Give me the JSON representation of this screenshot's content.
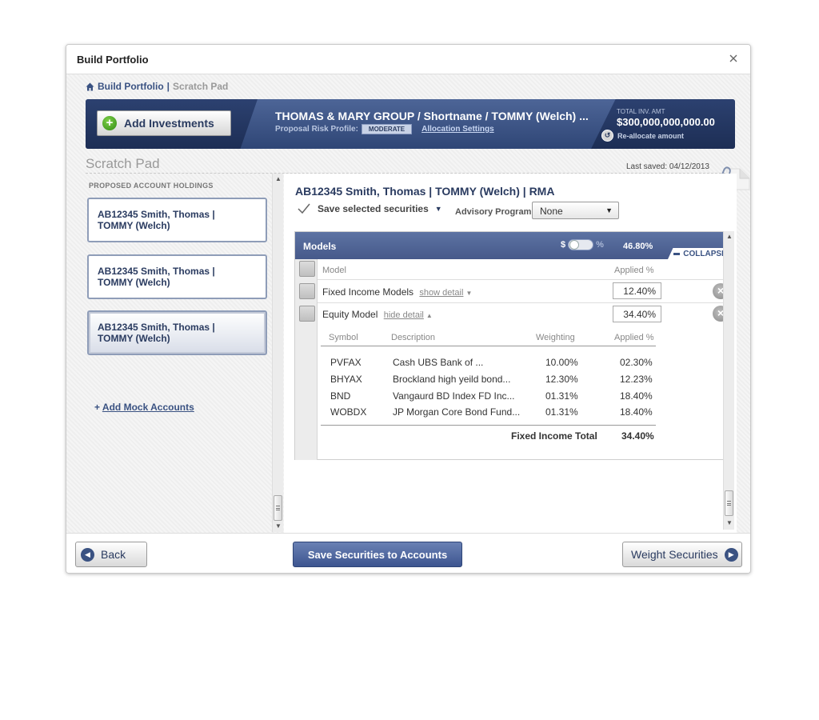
{
  "dialog": {
    "title": "Build Portfolio"
  },
  "breadcrumb": {
    "home_label": "Build Portfolio",
    "separator": "|",
    "current": "Scratch Pad"
  },
  "banner": {
    "add_investments_label": "Add Investments",
    "client_name": "THOMAS & MARY GROUP / Shortname / TOMMY (Welch) ...",
    "risk_label": "Proposal Risk Profile:",
    "risk_value": "MODERATE",
    "allocation_link": "Allocation Settings",
    "total_label": "TOTAL INV. AMT",
    "total_amount": "$300,000,000,000.00",
    "reallocate_label": "Re-allocate amount"
  },
  "scratch": {
    "title": "Scratch Pad",
    "last_saved": "Last saved: 04/12/2013"
  },
  "holdings": {
    "title": "PROPOSED ACCOUNT HOLDINGS",
    "accounts": [
      {
        "line1": "AB12345 Smith, Thomas |",
        "line2": "TOMMY (Welch)"
      },
      {
        "line1": "AB12345 Smith, Thomas |",
        "line2": "TOMMY (Welch)"
      },
      {
        "line1": "AB12345 Smith, Thomas |",
        "line2": "TOMMY (Welch)"
      }
    ],
    "add_mock_prefix": "+",
    "add_mock_label": "Add Mock Accounts"
  },
  "account": {
    "heading": "AB12345 Smith, Thomas | TOMMY (Welch) | RMA",
    "save_selected_label": "Save selected securities",
    "advisory_label": "Advisory Program:",
    "advisory_value": "None"
  },
  "models": {
    "title": "Models",
    "toggle_dollar": "$",
    "toggle_percent": "%",
    "total_pct": "46.80%",
    "collapse_label": "COLLAPSE",
    "col_model": "Model",
    "col_applied": "Applied %",
    "rows": [
      {
        "name": "Fixed Income Models",
        "detail_link": "show detail",
        "applied": "12.40%"
      },
      {
        "name": "Equity Model",
        "detail_link": "hide detail",
        "applied": "34.40%"
      }
    ],
    "detail": {
      "headers": {
        "symbol": "Symbol",
        "description": "Description",
        "weighting": "Weighting",
        "applied": "Applied %"
      },
      "rows": [
        {
          "symbol": "PVFAX",
          "description": "Cash UBS Bank of ...",
          "weighting": "10.00%",
          "applied": "02.30%"
        },
        {
          "symbol": "BHYAX",
          "description": "Brockland high yeild bond...",
          "weighting": "12.30%",
          "applied": "12.23%"
        },
        {
          "symbol": "BND",
          "description": "Vangaurd BD Index FD Inc...",
          "weighting": "01.31%",
          "applied": "18.40%"
        },
        {
          "symbol": "WOBDX",
          "description": "JP Morgan Core Bond Fund...",
          "weighting": "01.31%",
          "applied": "18.40%"
        }
      ],
      "total_label": "Fixed Income Total",
      "total_value": "34.40%"
    }
  },
  "footer": {
    "back_label": "Back",
    "save_label": "Save Securities to Accounts",
    "weight_label": "Weight Securities"
  },
  "colors": {
    "brand_navy": "#3a5282",
    "banner_blue": "#4d6597",
    "add_green": "#2f8a12"
  }
}
